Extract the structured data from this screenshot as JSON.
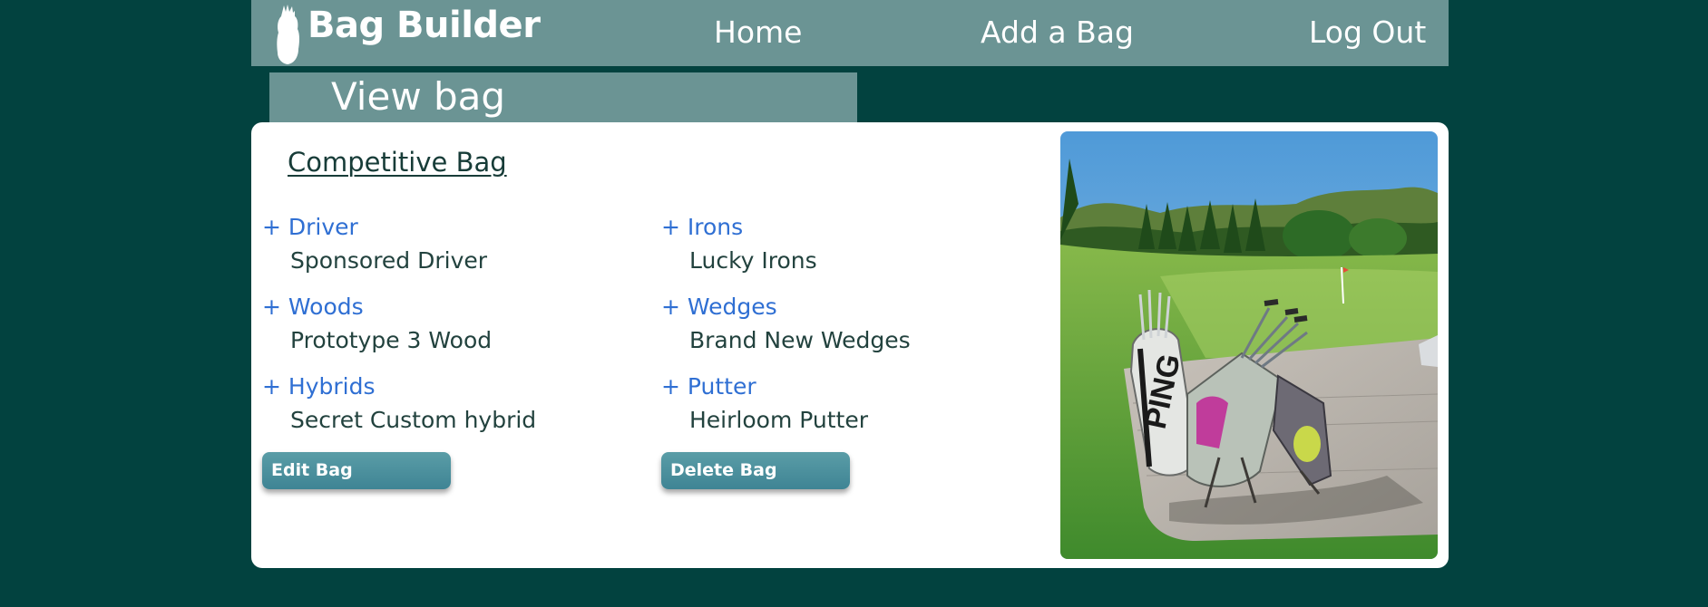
{
  "header": {
    "brand": "Bag Builder",
    "nav": {
      "home": "Home",
      "add_bag": "Add a Bag",
      "log_out": "Log Out"
    }
  },
  "page": {
    "tab_title": "View bag"
  },
  "bag": {
    "name": "Competitive Bag",
    "categories": [
      {
        "label": "+ Driver",
        "club": "Sponsored Driver"
      },
      {
        "label": "+ Woods",
        "club": "Prototype 3 Wood"
      },
      {
        "label": "+ Hybrids",
        "club": "Secret Custom hybrid"
      },
      {
        "label": "+ Irons",
        "club": "Lucky Irons"
      },
      {
        "label": "+ Wedges",
        "club": "Brand New Wedges"
      },
      {
        "label": "+ Putter",
        "club": "Heirloom Putter"
      }
    ],
    "actions": {
      "edit": "Edit Bag",
      "delete": "Delete Bag"
    },
    "photo_brand": "PING"
  },
  "colors": {
    "background": "#02423f",
    "header": "#6b9494",
    "category_link": "#2f6fd3",
    "button": "#4a8e9c"
  },
  "icons": {
    "logo": "golf-bag-icon"
  }
}
